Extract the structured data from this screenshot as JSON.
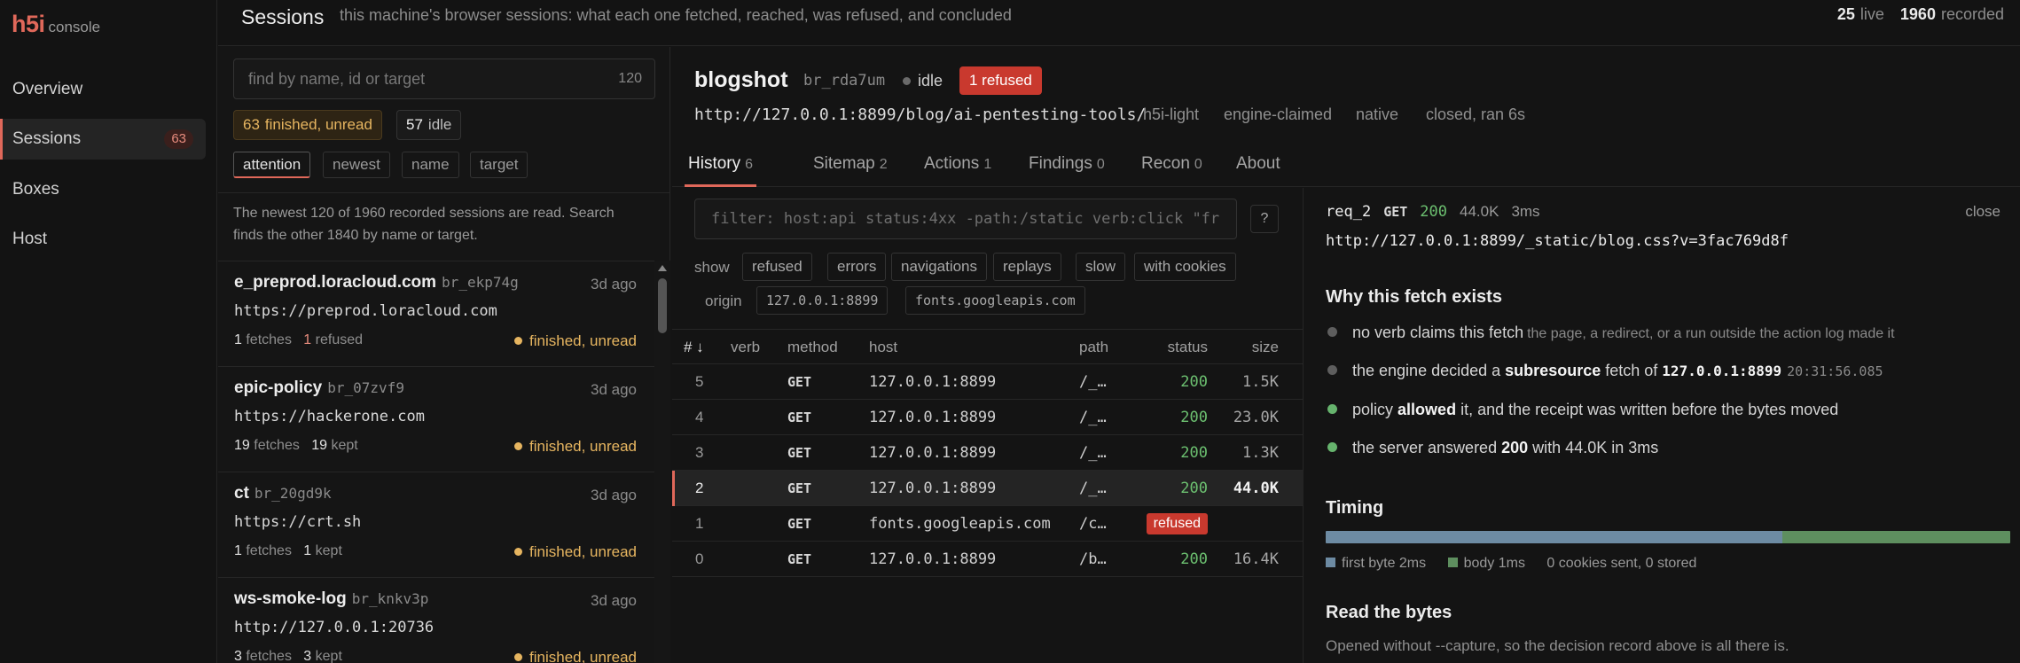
{
  "brand": {
    "logo": "h5i",
    "sub": "console"
  },
  "nav": [
    {
      "label": "Overview"
    },
    {
      "label": "Sessions",
      "badge": "63",
      "active": true
    },
    {
      "label": "Boxes"
    },
    {
      "label": "Host"
    }
  ],
  "header": {
    "title": "Sessions",
    "subtitle": "this machine's browser sessions: what each one fetched, reached, was refused, and concluded",
    "live_count": "25",
    "live_label": "live",
    "recorded_count": "1960",
    "recorded_label": "recorded"
  },
  "list": {
    "search_placeholder": "find by name, id or target",
    "search_count": "120",
    "chips": [
      {
        "count": "63",
        "label": "finished, unread"
      },
      {
        "count": "57",
        "label": "idle"
      }
    ],
    "sorts": [
      "attention",
      "newest",
      "name",
      "target"
    ],
    "note": "The newest 120 of 1960 recorded sessions are read. Search finds the other 1840 by name or target.",
    "sessions": [
      {
        "name": "e_preprod.loracloud.com",
        "id": "br_ekp74g",
        "age": "3d ago",
        "url": "https://preprod.loracloud.com",
        "fetches": "1",
        "fetches_label": "fetches",
        "second": "1",
        "second_label": "refused",
        "state": "finished, unread"
      },
      {
        "name": "epic-policy",
        "id": "br_07zvf9",
        "age": "3d ago",
        "url": "https://hackerone.com",
        "fetches": "19",
        "fetches_label": "fetches",
        "second": "19",
        "second_label": "kept",
        "state": "finished, unread"
      },
      {
        "name": "ct",
        "id": "br_20gd9k",
        "age": "3d ago",
        "url": "https://crt.sh",
        "fetches": "1",
        "fetches_label": "fetches",
        "second": "1",
        "second_label": "kept",
        "state": "finished, unread"
      },
      {
        "name": "ws-smoke-log",
        "id": "br_knkv3p",
        "age": "3d ago",
        "url": "http://127.0.0.1:20736",
        "fetches": "3",
        "fetches_label": "fetches",
        "second": "3",
        "second_label": "kept",
        "state": "finished, unread"
      }
    ]
  },
  "detail": {
    "name": "blogshot",
    "id": "br_rda7um",
    "state": "idle",
    "refused_badge": "1 refused",
    "url": "http://127.0.0.1:8899/blog/ai-pentesting-tools/",
    "meta": [
      "h5i-light",
      "engine-claimed",
      "native",
      "closed, ran 6s"
    ],
    "tabs": [
      {
        "label": "History",
        "count": "6"
      },
      {
        "label": "Sitemap",
        "count": "2"
      },
      {
        "label": "Actions",
        "count": "1"
      },
      {
        "label": "Findings",
        "count": "0"
      },
      {
        "label": "Recon",
        "count": "0"
      },
      {
        "label": "About",
        "count": ""
      }
    ]
  },
  "history": {
    "filter_placeholder": "filter: host:api status:4xx -path:/static verb:click \"fr",
    "help": "?",
    "show_label": "show",
    "show_chips": [
      "refused",
      "errors",
      "navigations",
      "replays",
      "slow",
      "with cookies"
    ],
    "origin_label": "origin",
    "origin_chips": [
      "127.0.0.1:8899",
      "fonts.googleapis.com"
    ],
    "columns": {
      "idx": "# ↓",
      "verb": "verb",
      "method": "method",
      "host": "host",
      "path": "path",
      "status": "status",
      "size": "size"
    },
    "rows": [
      {
        "idx": "5",
        "verb": "",
        "method": "GET",
        "host": "127.0.0.1:8899",
        "path": "/_…",
        "status": "200",
        "size": "1.5K"
      },
      {
        "idx": "4",
        "verb": "",
        "method": "GET",
        "host": "127.0.0.1:8899",
        "path": "/_…",
        "status": "200",
        "size": "23.0K"
      },
      {
        "idx": "3",
        "verb": "",
        "method": "GET",
        "host": "127.0.0.1:8899",
        "path": "/_…",
        "status": "200",
        "size": "1.3K"
      },
      {
        "idx": "2",
        "verb": "",
        "method": "GET",
        "host": "127.0.0.1:8899",
        "path": "/_…",
        "status": "200",
        "size": "44.0K",
        "selected": true
      },
      {
        "idx": "1",
        "verb": "",
        "method": "GET",
        "host": "fonts.googleapis.com",
        "path": "/c…",
        "status": "refused",
        "size": "",
        "refused": true
      },
      {
        "idx": "0",
        "verb": "",
        "method": "GET",
        "host": "127.0.0.1:8899",
        "path": "/b…",
        "status": "200",
        "size": "16.4K"
      }
    ]
  },
  "request": {
    "id": "req_2",
    "method": "GET",
    "status": "200",
    "size": "44.0K",
    "time": "3ms",
    "close": "close",
    "url": "http://127.0.0.1:8899/_static/blog.css?v=3fac769d8f",
    "why_title": "Why this fetch exists",
    "why": {
      "line1_main": "no verb claims this fetch",
      "line1_sub": "the page, a redirect, or a run outside the action log made it",
      "line2_pre": "the engine decided a",
      "line2_kind": "subresource",
      "line2_mid": "fetch of",
      "line2_host": "127.0.0.1:8899",
      "line2_ts": "20:31:56.085",
      "line3_pre": "policy",
      "line3_verb": "allowed",
      "line3_post": "it, and the receipt was written before the bytes moved",
      "line4_pre": "the server answered",
      "line4_status": "200",
      "line4_post": "with 44.0K in 3ms"
    },
    "timing_title": "Timing",
    "timing": {
      "first_byte_ms": 2,
      "body_ms": 1,
      "first_byte_label": "first byte 2ms",
      "body_label": "body 1ms",
      "cookies": "0 cookies sent, 0 stored"
    },
    "colors": {
      "first_byte": "#6d8ba3",
      "body": "#5e8f5f"
    },
    "bytes_title": "Read the bytes",
    "bytes_note": "Opened without --capture, so the decision record above is all there is."
  }
}
